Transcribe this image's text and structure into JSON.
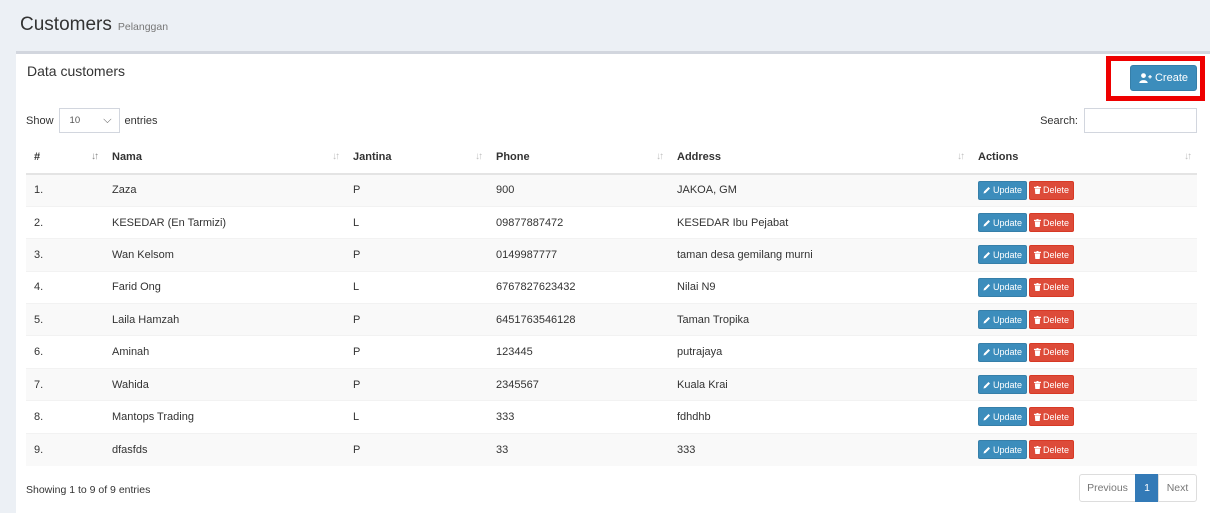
{
  "header": {
    "title": "Customers",
    "subtitle": "Pelanggan"
  },
  "box": {
    "title": "Data customers",
    "create_label": "Create"
  },
  "length": {
    "show_label": "Show",
    "value": "10",
    "entries_label": "entries"
  },
  "search": {
    "label": "Search:",
    "value": ""
  },
  "table": {
    "columns": [
      "#",
      "Nama",
      "Jantina",
      "Phone",
      "Address",
      "Actions"
    ],
    "update_label": "Update",
    "delete_label": "Delete",
    "rows": [
      {
        "no": "1.",
        "nama": "Zaza",
        "jantina": "P",
        "phone": "900",
        "address": "JAKOA, GM"
      },
      {
        "no": "2.",
        "nama": "KESEDAR (En Tarmizi)",
        "jantina": "L",
        "phone": "09877887472",
        "address": "KESEDAR Ibu Pejabat"
      },
      {
        "no": "3.",
        "nama": "Wan Kelsom",
        "jantina": "P",
        "phone": "0149987777",
        "address": "taman desa gemilang murni"
      },
      {
        "no": "4.",
        "nama": "Farid Ong",
        "jantina": "L",
        "phone": "6767827623432",
        "address": "Nilai N9"
      },
      {
        "no": "5.",
        "nama": "Laila Hamzah",
        "jantina": "P",
        "phone": "6451763546128",
        "address": "Taman Tropika"
      },
      {
        "no": "6.",
        "nama": "Aminah",
        "jantina": "P",
        "phone": "123445",
        "address": "putrajaya"
      },
      {
        "no": "7.",
        "nama": "Wahida",
        "jantina": "P",
        "phone": "2345567",
        "address": "Kuala Krai"
      },
      {
        "no": "8.",
        "nama": "Mantops Trading",
        "jantina": "L",
        "phone": "333",
        "address": "fdhdhb"
      },
      {
        "no": "9.",
        "nama": "dfasfds",
        "jantina": "P",
        "phone": "33",
        "address": "333"
      }
    ]
  },
  "info": "Showing 1 to 9 of 9 entries",
  "pagination": {
    "previous": "Previous",
    "page": "1",
    "next": "Next"
  },
  "colors": {
    "primary": "#3c8dbc",
    "danger": "#dd4b39",
    "highlight": "#ee0000",
    "background": "#ecf0f5"
  }
}
